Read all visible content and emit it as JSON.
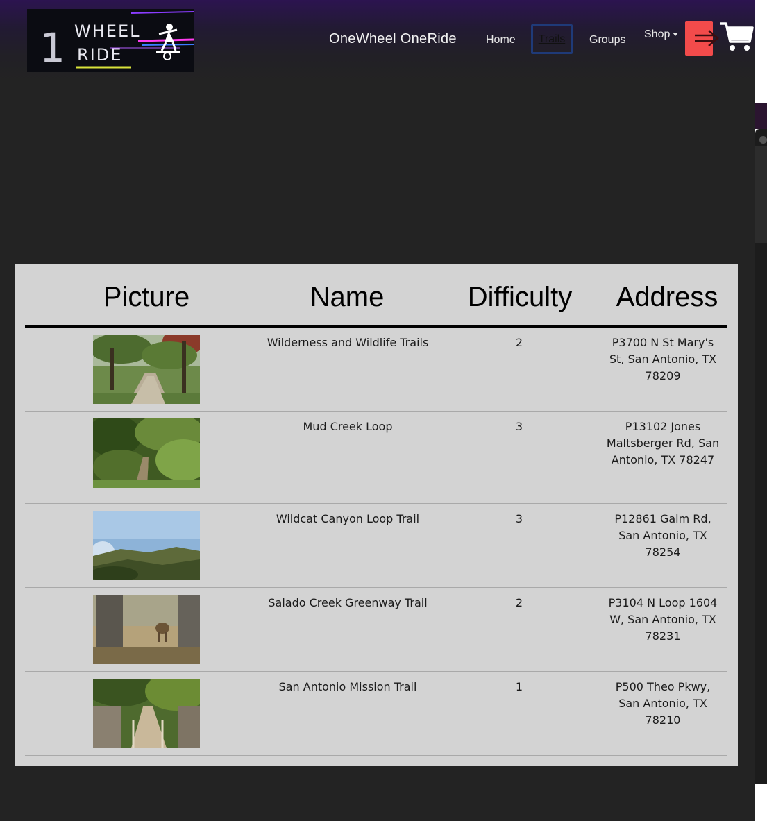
{
  "navbar": {
    "logo_text": "1 WHEEL RIDE",
    "brand": "OneWheel OneRide",
    "links": {
      "home": "Home",
      "trails": "Trails",
      "groups": "Groups",
      "shop": "Shop"
    },
    "icons": {
      "logout": "arrow-right-icon",
      "cart": "cart-icon",
      "shop_caret": "caret-down-icon"
    },
    "colors": {
      "logout_button": "#f24b4b",
      "active_outline": "#1f3a78"
    }
  },
  "table": {
    "headers": [
      "Picture",
      "Name",
      "Difficulty",
      "Address"
    ],
    "rows": [
      {
        "picture": "trail-photo-wooded-path",
        "name": "Wilderness and Wildlife Trails",
        "difficulty": "2",
        "address": "P3700 N St Mary's St, San Antonio, TX 78209"
      },
      {
        "picture": "trail-photo-green-brush",
        "name": "Mud Creek Loop",
        "difficulty": "3",
        "address": "P13102 Jones Maltsberger Rd, San Antonio, TX 78247"
      },
      {
        "picture": "trail-photo-canyon-view",
        "name": "Wildcat Canyon Loop Trail",
        "difficulty": "3",
        "address": "P12861 Galm Rd, San Antonio, TX 78254"
      },
      {
        "picture": "trail-photo-deer-trees",
        "name": "Salado Creek Greenway Trail",
        "difficulty": "2",
        "address": "P3104 N Loop 1604 W, San Antonio, TX 78231"
      },
      {
        "picture": "trail-photo-boardwalk",
        "name": "San Antonio Mission Trail",
        "difficulty": "1",
        "address": "P500 Theo Pkwy, San Antonio, TX 78210"
      }
    ]
  }
}
